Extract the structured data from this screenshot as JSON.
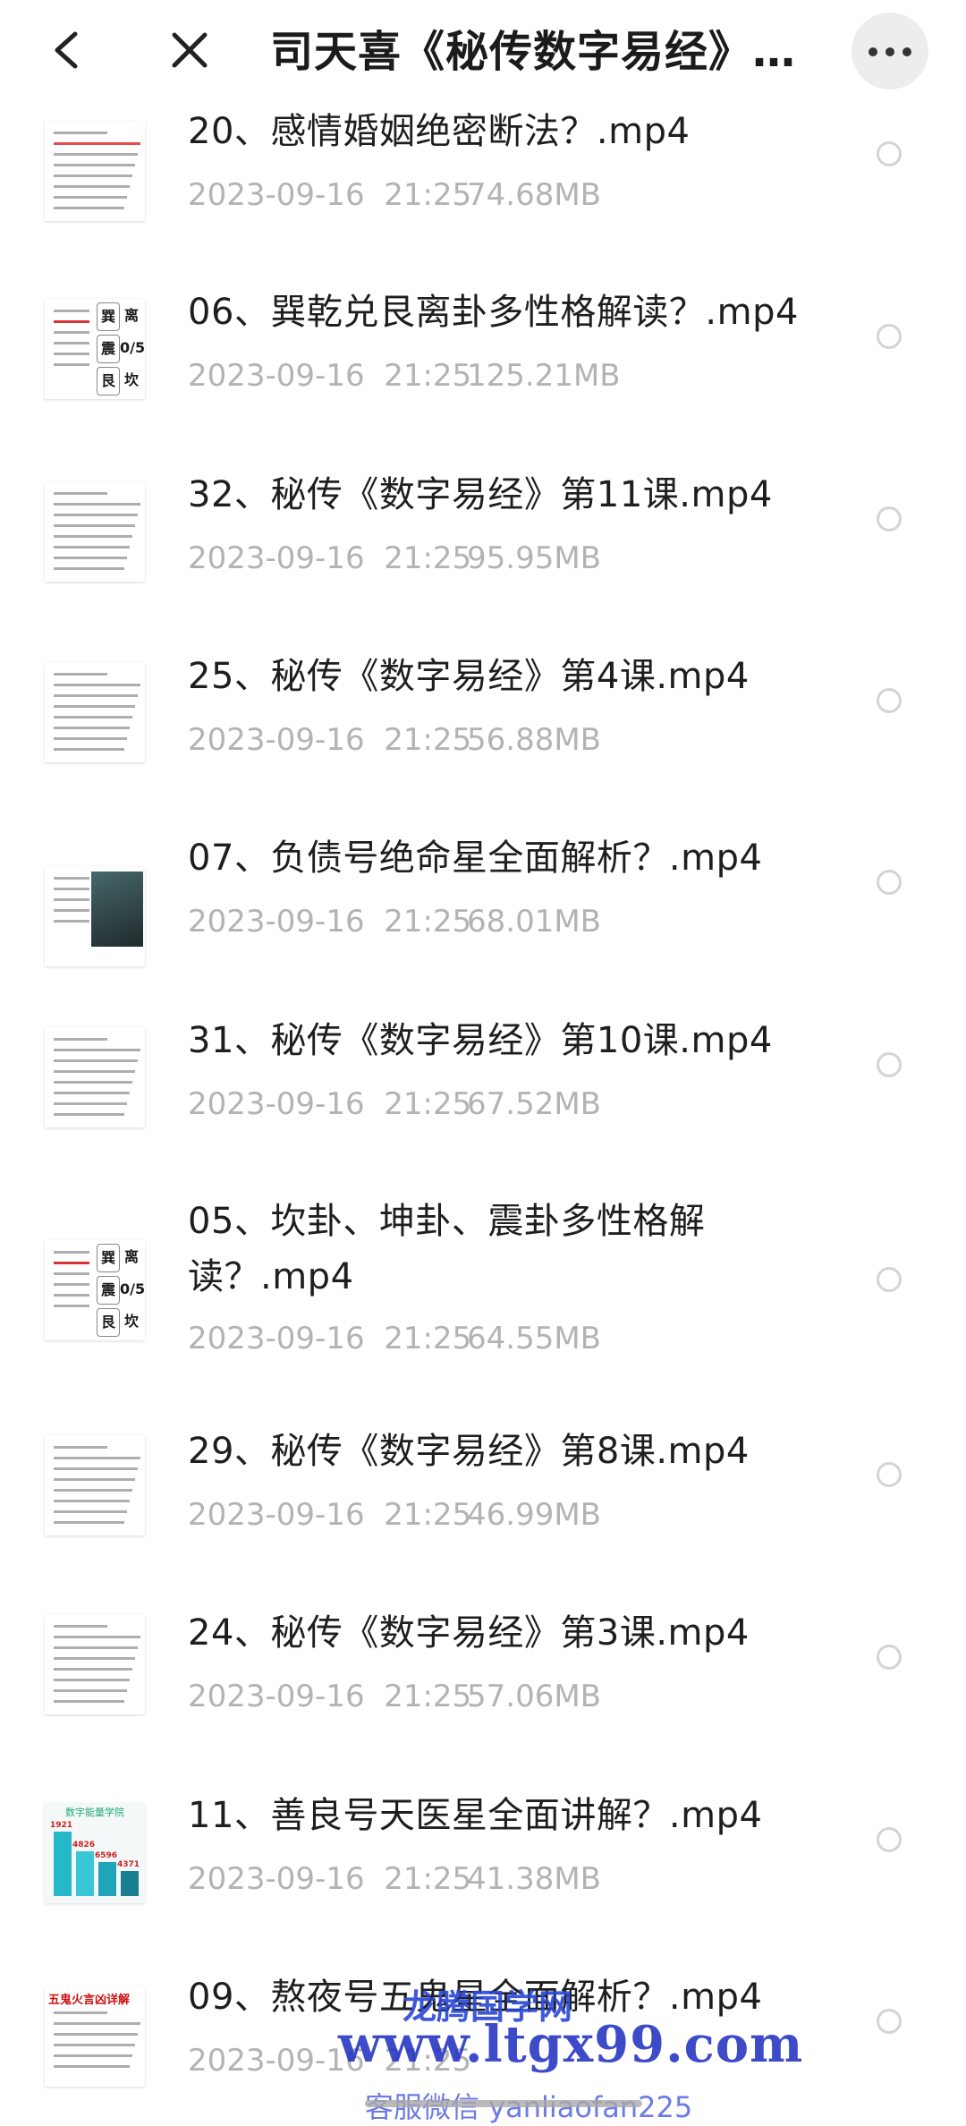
{
  "header": {
    "title": "司天喜《秘传数字易经》3…"
  },
  "files": [
    {
      "name": "20、感情婚姻绝密断法？.mp4",
      "date": "2023-09-16  21:25",
      "size": "74.68MB",
      "thumb": "doc-red"
    },
    {
      "name": "06、巽乾兑艮离卦多性格解读？.mp4",
      "date": "2023-09-16  21:25",
      "size": "125.21MB",
      "thumb": "trigram",
      "thumb_chars": [
        "巽",
        "离",
        "震",
        "0/5",
        "艮",
        "坎"
      ]
    },
    {
      "name": "32、秘传《数字易经》第11课.mp4",
      "date": "2023-09-16  21:25",
      "size": "95.95MB",
      "thumb": "doc"
    },
    {
      "name": "25、秘传《数字易经》第4课.mp4",
      "date": "2023-09-16  21:25",
      "size": "56.88MB",
      "thumb": "doc"
    },
    {
      "name": "07、负债号绝命星全面解析？.mp4",
      "date": "2023-09-16  21:25",
      "size": "68.01MB",
      "thumb": "photo"
    },
    {
      "name": "31、秘传《数字易经》第10课.mp4",
      "date": "2023-09-16  21:25",
      "size": "67.52MB",
      "thumb": "doc"
    },
    {
      "name": "05、坎卦、坤卦、震卦多性格解读？.mp4",
      "date": "2023-09-16  21:25",
      "size": "64.55MB",
      "thumb": "trigram",
      "thumb_chars": [
        "巽",
        "离",
        "震",
        "0/5",
        "艮",
        "坎"
      ]
    },
    {
      "name": "29、秘传《数字易经》第8课.mp4",
      "date": "2023-09-16  21:25",
      "size": "46.99MB",
      "thumb": "doc"
    },
    {
      "name": "24、秘传《数字易经》第3课.mp4",
      "date": "2023-09-16  21:25",
      "size": "57.06MB",
      "thumb": "doc"
    },
    {
      "name": "11、善良号天医星全面讲解？.mp4",
      "date": "2023-09-16  21:25",
      "size": "41.38MB",
      "thumb": "chart",
      "thumb_title": "数字能量学院",
      "thumb_values": [
        "1921",
        "4826",
        "6596",
        "4371"
      ]
    },
    {
      "name": "09、熬夜号五鬼星全面解析？.mp4",
      "date": "2023-09-16  21:25",
      "size": "",
      "thumb": "doc-title",
      "thumb_title": "五鬼火言凶详解"
    }
  ],
  "watermark": {
    "top": "龙腾国学网",
    "url": "www.ltgx99.com",
    "contact": "客服微信 yanliaofan225"
  },
  "colors": {
    "text": "#1e1e1e",
    "meta": "#b3b3b3",
    "watermark": "#2433c2"
  }
}
